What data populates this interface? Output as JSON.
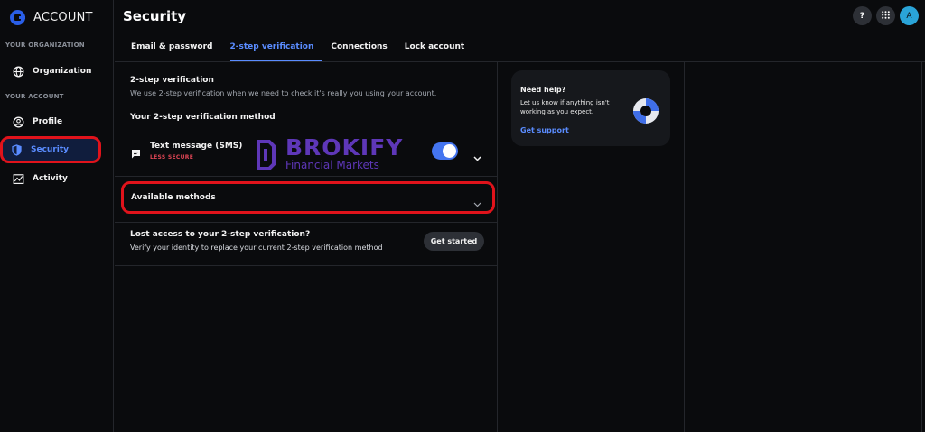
{
  "brand": {
    "title": "ACCOUNT"
  },
  "sidebar": {
    "section_org": "YOUR ORGANIZATION",
    "section_account": "YOUR ACCOUNT",
    "items": [
      {
        "label": "Organization",
        "icon": "globe-icon"
      },
      {
        "label": "Profile",
        "icon": "user-icon"
      },
      {
        "label": "Security",
        "icon": "shield-icon",
        "active": true
      },
      {
        "label": "Activity",
        "icon": "activity-chart-icon"
      }
    ]
  },
  "header": {
    "title": "Security",
    "help_glyph": "?",
    "apps_icon": "grid-icon",
    "avatar_initial": "A"
  },
  "tabs": [
    {
      "label": "Email & password"
    },
    {
      "label": "2-step verification",
      "active": true
    },
    {
      "label": "Connections"
    },
    {
      "label": "Lock account"
    }
  ],
  "two_step": {
    "heading": "2-step verification",
    "description": "We use 2-step verification when we need to check it's really you using your account.",
    "method_heading": "Your 2-step verification method",
    "method": {
      "title": "Text message (SMS)",
      "badge": "LESS SECURE",
      "enabled": true
    },
    "available_methods": "Available methods",
    "lost_access": {
      "title": "Lost access to your 2-step verification?",
      "description": "Verify your identity to replace your current 2-step verification method",
      "button": "Get started"
    }
  },
  "watermark": {
    "name": "BROKIFY",
    "subtitle": "Financial Markets"
  },
  "help": {
    "title": "Need help?",
    "body": "Let us know if anything isn't working as you expect.",
    "link": "Get support"
  },
  "colors": {
    "background": "#0a0b0d",
    "accent": "#5a8cff",
    "toggle": "#4475f0",
    "warning": "#e04655",
    "highlight": "#e0131b",
    "watermark": "#5e37b8"
  }
}
